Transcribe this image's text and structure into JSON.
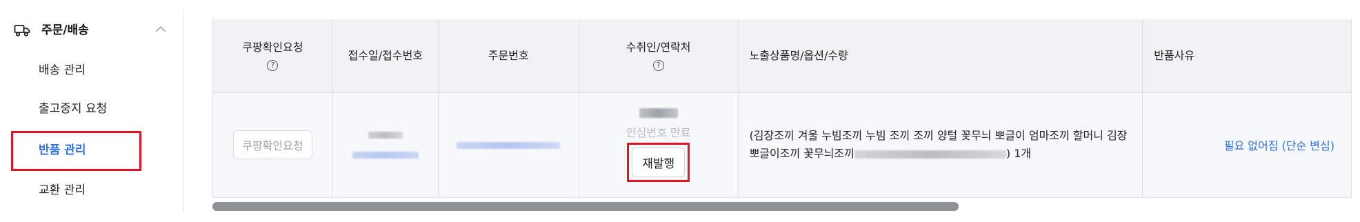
{
  "sidebar": {
    "section_label": "주문/배송",
    "items": [
      {
        "label": "배송 관리"
      },
      {
        "label": "출고중지 요청"
      },
      {
        "label": "반품 관리"
      },
      {
        "label": "교환 관리"
      }
    ],
    "active_index": 2
  },
  "table": {
    "headers": {
      "coupang_check": "쿠팡확인요청",
      "receipt": "접수일/접수번호",
      "order_no": "주문번호",
      "recipient": "수취인/연락처",
      "product": "노출상품명/옵션/수량",
      "reason": "반품사유"
    },
    "help_glyph": "?",
    "row": {
      "coupang_check_button": "쿠팡확인요청",
      "safe_number_status": "안심번호 만료",
      "reissue_button": "재발행",
      "product_text_1": "(김장조끼 겨울 누빔조끼 누빔 조끼 조끼 양털 꽃무늬 뽀글이 엄마조끼 할머니 김장 뽀글이조끼 꽃무늬조끼",
      "product_text_2": ") 1개",
      "reason_link": "필요 없어짐 (단순 변심)"
    }
  },
  "colors": {
    "accent_blue": "#2f6fe5",
    "highlight_red": "#e2141f",
    "header_bg": "#f1f2f4"
  },
  "icons": {
    "section": "truck-icon",
    "collapse": "chevron-up-icon",
    "help": "question-circle-icon"
  }
}
